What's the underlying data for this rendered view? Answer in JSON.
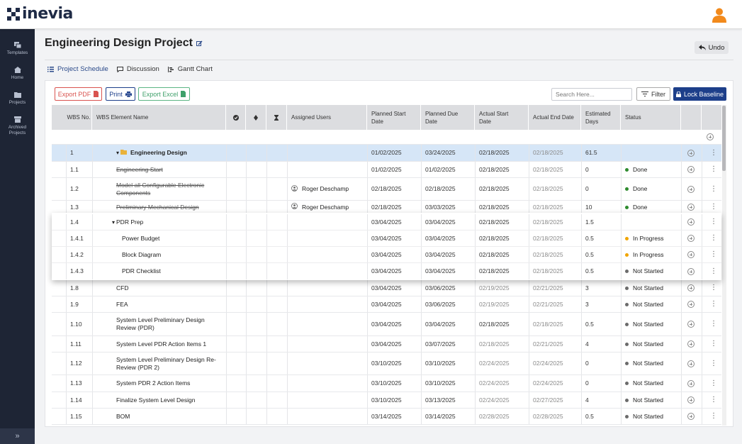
{
  "app": {
    "logo_text": "inevia"
  },
  "sidebar": {
    "items": [
      {
        "label": "Templates",
        "icon": "templates-icon"
      },
      {
        "label": "Home",
        "icon": "home-icon"
      },
      {
        "label": "Projects",
        "icon": "folder-icon"
      },
      {
        "label": "Archived Projects",
        "icon": "archive-icon"
      }
    ],
    "collapse_icon": "»"
  },
  "header": {
    "title": "Engineering Design Project",
    "undo_label": "Undo"
  },
  "tabs": [
    {
      "label": "Project Schedule",
      "icon": "list-icon",
      "active": true
    },
    {
      "label": "Discussion",
      "icon": "chat-icon",
      "active": false
    },
    {
      "label": "Gantt Chart",
      "icon": "gantt-icon",
      "active": false
    }
  ],
  "toolbar": {
    "export_pdf": "Export PDF",
    "print": "Print",
    "export_excel": "Export Excel",
    "search_placeholder": "Search Here...",
    "filter": "Filter",
    "lock_baseline": "Lock Baseline"
  },
  "columns": [
    "WBS No.",
    "WBS Element Name",
    "",
    "",
    "",
    "Assigned Users",
    "Planned Start Date",
    "Planned Due Date",
    "Actual Start Date",
    "Actual End Date",
    "Estimated Days",
    "Status"
  ],
  "rows": [
    {
      "wbs": "1",
      "name": "Engineering Design",
      "user": "",
      "ps": "01/02/2025",
      "pd": "03/24/2025",
      "as": "02/18/2025",
      "ae": "02/18/2025",
      "days": "61.5",
      "status": ""
    },
    {
      "wbs": "1.1",
      "name": "Engineering Start",
      "user": "",
      "ps": "01/02/2025",
      "pd": "01/02/2025",
      "as": "02/18/2025",
      "ae": "02/18/2025",
      "days": "0",
      "status": "Done"
    },
    {
      "wbs": "1.2",
      "name": "Model all Configurable Electronic Components",
      "user": "Roger Deschamp",
      "ps": "02/18/2025",
      "pd": "02/18/2025",
      "as": "02/18/2025",
      "ae": "02/18/2025",
      "days": "0",
      "status": "Done"
    },
    {
      "wbs": "1.3",
      "name": "Preliminary Mechanical Design",
      "user": "Roger Deschamp",
      "ps": "02/18/2025",
      "pd": "03/03/2025",
      "as": "02/18/2025",
      "ae": "02/18/2025",
      "days": "10",
      "status": "Done"
    },
    {
      "wbs": "1.4",
      "name": "PDR Prep",
      "user": "",
      "ps": "03/04/2025",
      "pd": "03/04/2025",
      "as": "02/18/2025",
      "ae": "02/18/2025",
      "days": "1.5",
      "status": ""
    },
    {
      "wbs": "1.4.1",
      "name": "Power Budget",
      "user": "",
      "ps": "03/04/2025",
      "pd": "03/04/2025",
      "as": "02/18/2025",
      "ae": "02/18/2025",
      "days": "0.5",
      "status": "In Progress"
    },
    {
      "wbs": "1.4.2",
      "name": "Block Diagram",
      "user": "",
      "ps": "03/04/2025",
      "pd": "03/04/2025",
      "as": "02/18/2025",
      "ae": "02/18/2025",
      "days": "0.5",
      "status": "In Progress"
    },
    {
      "wbs": "1.4.3",
      "name": "PDR Checklist",
      "user": "",
      "ps": "03/04/2025",
      "pd": "03/04/2025",
      "as": "02/18/2025",
      "ae": "02/18/2025",
      "days": "0.5",
      "status": "Not Started"
    },
    {
      "wbs": "1.8",
      "name": "CFD",
      "user": "",
      "ps": "03/04/2025",
      "pd": "03/06/2025",
      "as": "02/19/2025",
      "ae": "02/21/2025",
      "days": "3",
      "status": "Not Started"
    },
    {
      "wbs": "1.9",
      "name": "FEA",
      "user": "",
      "ps": "03/04/2025",
      "pd": "03/06/2025",
      "as": "02/19/2025",
      "ae": "02/21/2025",
      "days": "3",
      "status": "Not Started"
    },
    {
      "wbs": "1.10",
      "name": "System Level Preliminary Design Review (PDR)",
      "user": "",
      "ps": "03/04/2025",
      "pd": "03/04/2025",
      "as": "02/18/2025",
      "ae": "02/18/2025",
      "days": "0.5",
      "status": "Not Started"
    },
    {
      "wbs": "1.11",
      "name": "System Level PDR Action Items 1",
      "user": "",
      "ps": "03/04/2025",
      "pd": "03/07/2025",
      "as": "02/18/2025",
      "ae": "02/21/2025",
      "days": "4",
      "status": "Not Started"
    },
    {
      "wbs": "1.12",
      "name": "System Level Preliminary Design Re-Review (PDR 2)",
      "user": "",
      "ps": "03/10/2025",
      "pd": "03/10/2025",
      "as": "02/24/2025",
      "ae": "02/24/2025",
      "days": "0",
      "status": "Not Started"
    },
    {
      "wbs": "1.13",
      "name": "System PDR 2 Action Items",
      "user": "",
      "ps": "03/10/2025",
      "pd": "03/10/2025",
      "as": "02/24/2025",
      "ae": "02/24/2025",
      "days": "0",
      "status": "Not Started"
    },
    {
      "wbs": "1.14",
      "name": "Finalize System Level Design",
      "user": "",
      "ps": "03/10/2025",
      "pd": "03/13/2025",
      "as": "02/24/2025",
      "ae": "02/27/2025",
      "days": "4",
      "status": "Not Started"
    },
    {
      "wbs": "1.15",
      "name": "BOM",
      "user": "",
      "ps": "03/14/2025",
      "pd": "03/14/2025",
      "as": "02/28/2025",
      "ae": "02/28/2025",
      "days": "0.5",
      "status": "Not Started"
    }
  ],
  "status_colors": {
    "Done": "#2e8b2e",
    "In Progress": "#f0a500",
    "Not Started": "#6b6b6b"
  },
  "colors": {
    "accent": "#1d3f8a",
    "sidebar": "#1e2535",
    "selected_row": "#d6e6f7",
    "header": "#dcdde0"
  }
}
